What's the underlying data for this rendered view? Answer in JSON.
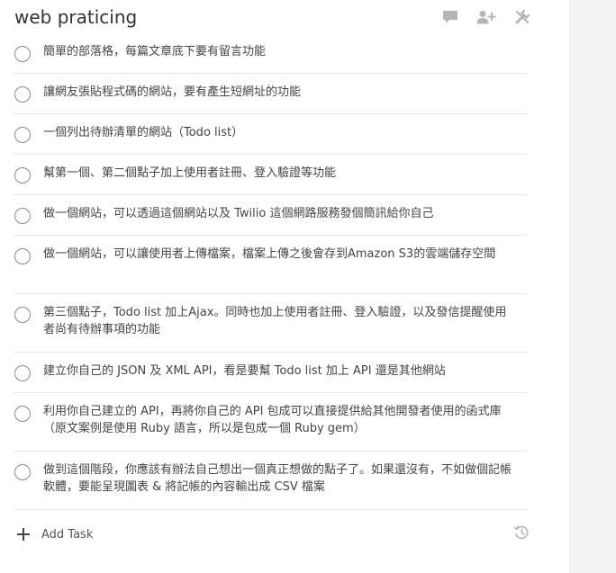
{
  "list": {
    "title": "web praticing"
  },
  "header_icons": [
    "comment-icon",
    "add-user-icon",
    "wrench-icon"
  ],
  "tasks": [
    {
      "text": "簡單的部落格，每篇文章底下要有留言功能"
    },
    {
      "text": "讓網友張貼程式碼的網站，要有產生短網址的功能"
    },
    {
      "text": "一個列出待辦清單的網站（Todo list）"
    },
    {
      "text": "幫第一個、第二個點子加上使用者註冊、登入驗證等功能"
    },
    {
      "text": "做一個網站，可以透過這個網站以及 Twilio 這個網路服務發個簡訊給你自己"
    },
    {
      "text": "做一個網站，可以讓使用者上傳檔案，檔案上傳之後會存到Amazon S3的雲端儲存空間"
    },
    {
      "text": "第三個點子，Todo list 加上Ajax。同時也加上使用者註冊、登入驗證，以及發信提醒使用者尚有待辦事項的功能"
    },
    {
      "text": "建立你自己的 JSON 及 XML API，看是要幫 Todo list 加上 API 還是其他網站"
    },
    {
      "text": "利用你自己建立的 API，再將你自己的 API 包成可以直接提供給其他開發者使用的函式庫（原文案例是使用 Ruby 語言，所以是包成一個 Ruby gem）"
    },
    {
      "text": "做到這個階段，你應該有辦法自己想出一個真正想做的點子了。如果還沒有，不如做個記帳軟體，要能呈現圖表 & 將記帳的內容輸出成 CSV 檔案"
    }
  ],
  "add_task": {
    "label": "Add Task"
  },
  "colors": {
    "accent_icon": "#b5b5b5",
    "side_strip": "#f3f3f3",
    "divider": "#e8e8e8"
  }
}
